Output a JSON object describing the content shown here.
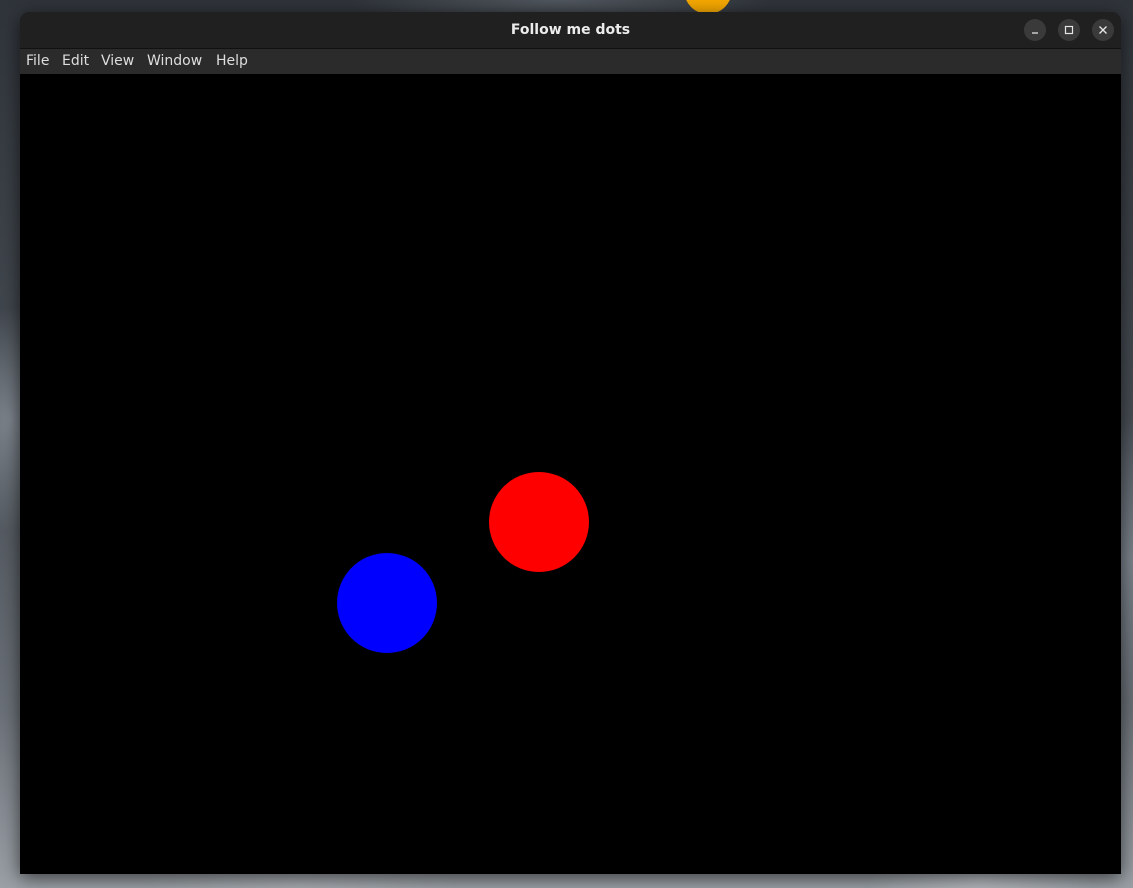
{
  "window": {
    "title": "Follow me dots"
  },
  "menubar": {
    "items": [
      {
        "label": "File"
      },
      {
        "label": "Edit"
      },
      {
        "label": "View"
      },
      {
        "label": "Window"
      },
      {
        "label": "Help"
      }
    ]
  },
  "canvas": {
    "background_color": "#000000",
    "dots": [
      {
        "color_name": "red",
        "color": "#ff0000"
      },
      {
        "color_name": "blue",
        "color": "#0000ff"
      }
    ]
  },
  "window_controls": {
    "minimize_icon": "minimize-icon",
    "maximize_icon": "maximize-icon",
    "close_icon": "close-icon"
  }
}
